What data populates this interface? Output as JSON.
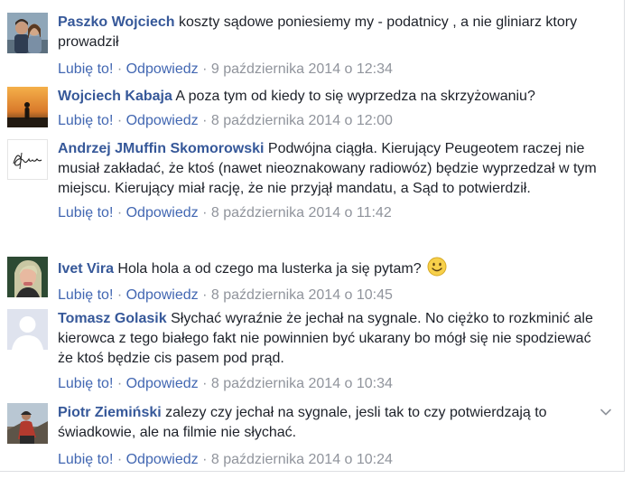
{
  "comments": [
    {
      "author": "Paszko Wojciech",
      "text": "koszty sądowe poniesiemy my - podatnicy , a nie gliniarz ktory prowadził",
      "like_label": "Lubię to!",
      "reply_label": "Odpowiedz",
      "separator": " · ",
      "timestamp": "9 października 2014 o 12:34",
      "avatar_icon": "couple-photo-avatar"
    },
    {
      "author": "Wojciech Kabaja",
      "text": "A poza tym od kiedy to się wyprzedza na skrzyżowaniu?",
      "like_label": "Lubię to!",
      "reply_label": "Odpowiedz",
      "separator": " · ",
      "timestamp": "8 października 2014 o 12:00",
      "avatar_icon": "sunset-silhouette-avatar"
    },
    {
      "author": "Andrzej JMuffin Skomorowski",
      "text": "Podwójna ciągła. Kierujący Peugeotem raczej nie musiał zakładać, że ktoś (nawet nieoznakowany radiowóz) będzie wyprzedzał w tym miejscu. Kierujący miał rację, że nie przyjął mandatu, a Sąd to potwierdził.",
      "like_label": "Lubię to!",
      "reply_label": "Odpowiedz",
      "separator": " · ",
      "timestamp": "8 października 2014 o 11:42",
      "avatar_icon": "signature-logo-avatar"
    },
    {
      "author": "Ivet Vira",
      "text": "Hola hola a od czego ma lusterka ja się pytam?",
      "like_label": "Lubię to!",
      "reply_label": "Odpowiedz",
      "separator": " · ",
      "timestamp": "8 października 2014 o 10:45",
      "avatar_icon": "portrait-photo-avatar",
      "emoji": "smile-emoji"
    },
    {
      "author": "Tomasz Golasik",
      "text": "Słychać wyraźnie że jechał na sygnale. No ciężko to rozkminić ale kierowca z tego białego fakt nie powinnien być ukarany bo mógł się nie spodziewać że ktoś będzie cis pasem pod prąd.",
      "like_label": "Lubię to!",
      "reply_label": "Odpowiedz",
      "separator": " · ",
      "timestamp": "8 października 2014 o 10:34",
      "avatar_icon": "default-silhouette-avatar"
    },
    {
      "author": "Piotr Ziemiński",
      "text": "zalezy czy jechał na sygnale, jesli tak to czy potwierdzają to świadkowie, ale na filmie nie słychać.",
      "like_label": "Lubię to!",
      "reply_label": "Odpowiedz",
      "separator": " · ",
      "timestamp": "8 października 2014 o 10:24",
      "avatar_icon": "outdoor-photo-avatar"
    }
  ],
  "colors": {
    "author": "#365899",
    "link": "#4267b2",
    "meta": "#90949c",
    "text": "#1d2129"
  },
  "options_icon": "chevron-down-icon"
}
